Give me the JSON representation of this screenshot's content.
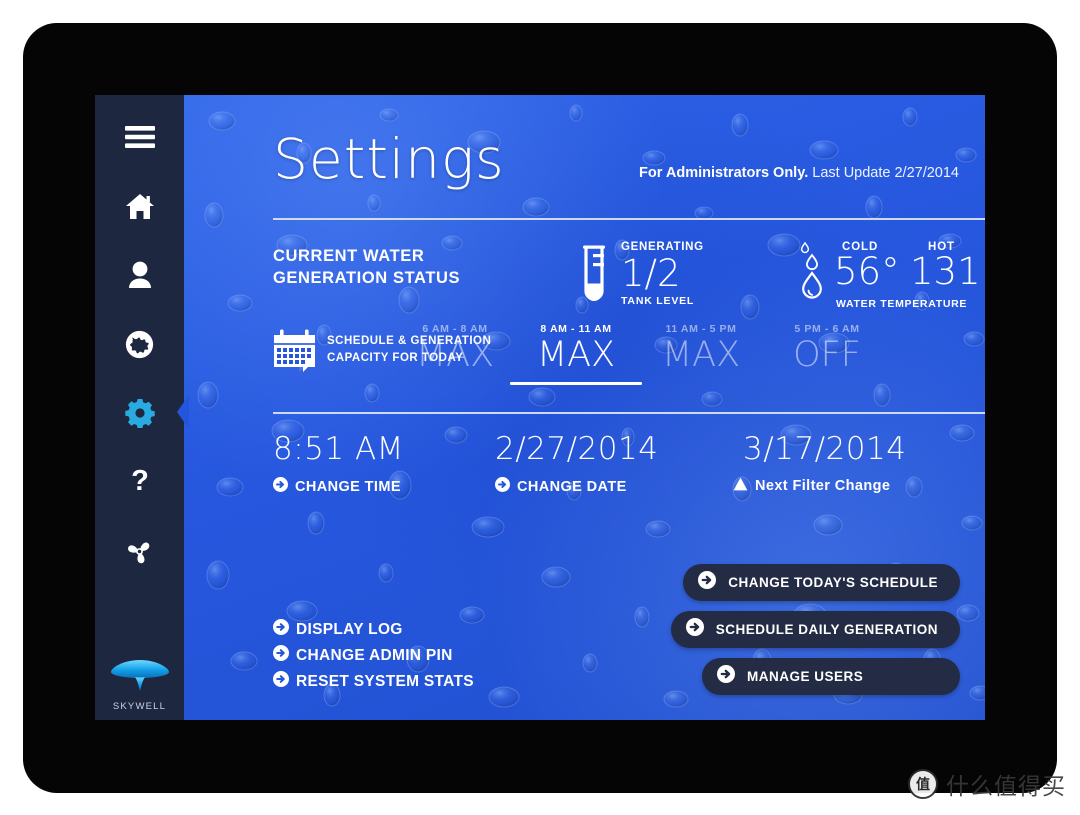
{
  "colors": {
    "screen_blue": "#2455dd",
    "sidebar_navy": "#1e2740",
    "accent_cyan": "#29abe2",
    "button_navy": "#232c44",
    "text_white": "#ffffff"
  },
  "sidebar": {
    "items": [
      {
        "name": "menu",
        "icon": "hamburger-icon",
        "active": false
      },
      {
        "name": "home",
        "icon": "home-icon",
        "active": false
      },
      {
        "name": "user",
        "icon": "person-icon",
        "active": false
      },
      {
        "name": "global",
        "icon": "globe-icon",
        "active": false
      },
      {
        "name": "settings",
        "icon": "gear-icon",
        "active": true
      },
      {
        "name": "help",
        "icon": "question-mark-icon",
        "active": false
      },
      {
        "name": "fan",
        "icon": "fan-icon",
        "active": false
      }
    ],
    "brand": "SKYWELL"
  },
  "header": {
    "title": "Settings",
    "admin_note": "For Administrators Only.",
    "last_update": "Last Update 2/27/2014"
  },
  "status": {
    "label_line1": "CURRENT WATER",
    "label_line2": "GENERATION STATUS",
    "tank": {
      "top_label": "GENERATING",
      "value": "1/2",
      "bottom_label": "TANK LEVEL"
    },
    "temperature": {
      "cold_label": "COLD",
      "cold_value": "56°",
      "hot_label": "HOT",
      "hot_value": "131°",
      "caption": "WATER TEMPERATURE"
    }
  },
  "schedule": {
    "label_line1": "SCHEDULE & GENERATION",
    "label_line2": "CAPACITY FOR TODAY",
    "slots": [
      {
        "time": "6 AM - 8 AM",
        "capacity": "MAX",
        "active": false
      },
      {
        "time": "8 AM - 11 AM",
        "capacity": "MAX",
        "active": true
      },
      {
        "time": "11 AM - 5 PM",
        "capacity": "MAX",
        "active": false
      },
      {
        "time": "5 PM - 6 AM",
        "capacity": "OFF",
        "active": false
      }
    ]
  },
  "datetime": {
    "time_value": "8:51 AM",
    "time_link": "CHANGE TIME",
    "date_value": "2/27/2014",
    "date_link": "CHANGE DATE",
    "filter_value": "3/17/2014",
    "filter_link": "Next Filter Change"
  },
  "bottom_links": [
    {
      "label": "DISPLAY LOG"
    },
    {
      "label": "CHANGE ADMIN PIN"
    },
    {
      "label": "RESET SYSTEM STATS"
    }
  ],
  "action_buttons": [
    {
      "label": "CHANGE TODAY'S SCHEDULE"
    },
    {
      "label": "SCHEDULE DAILY GENERATION"
    },
    {
      "label": "MANAGE USERS"
    }
  ],
  "watermark": {
    "badge": "值",
    "text": "什么值得买"
  }
}
